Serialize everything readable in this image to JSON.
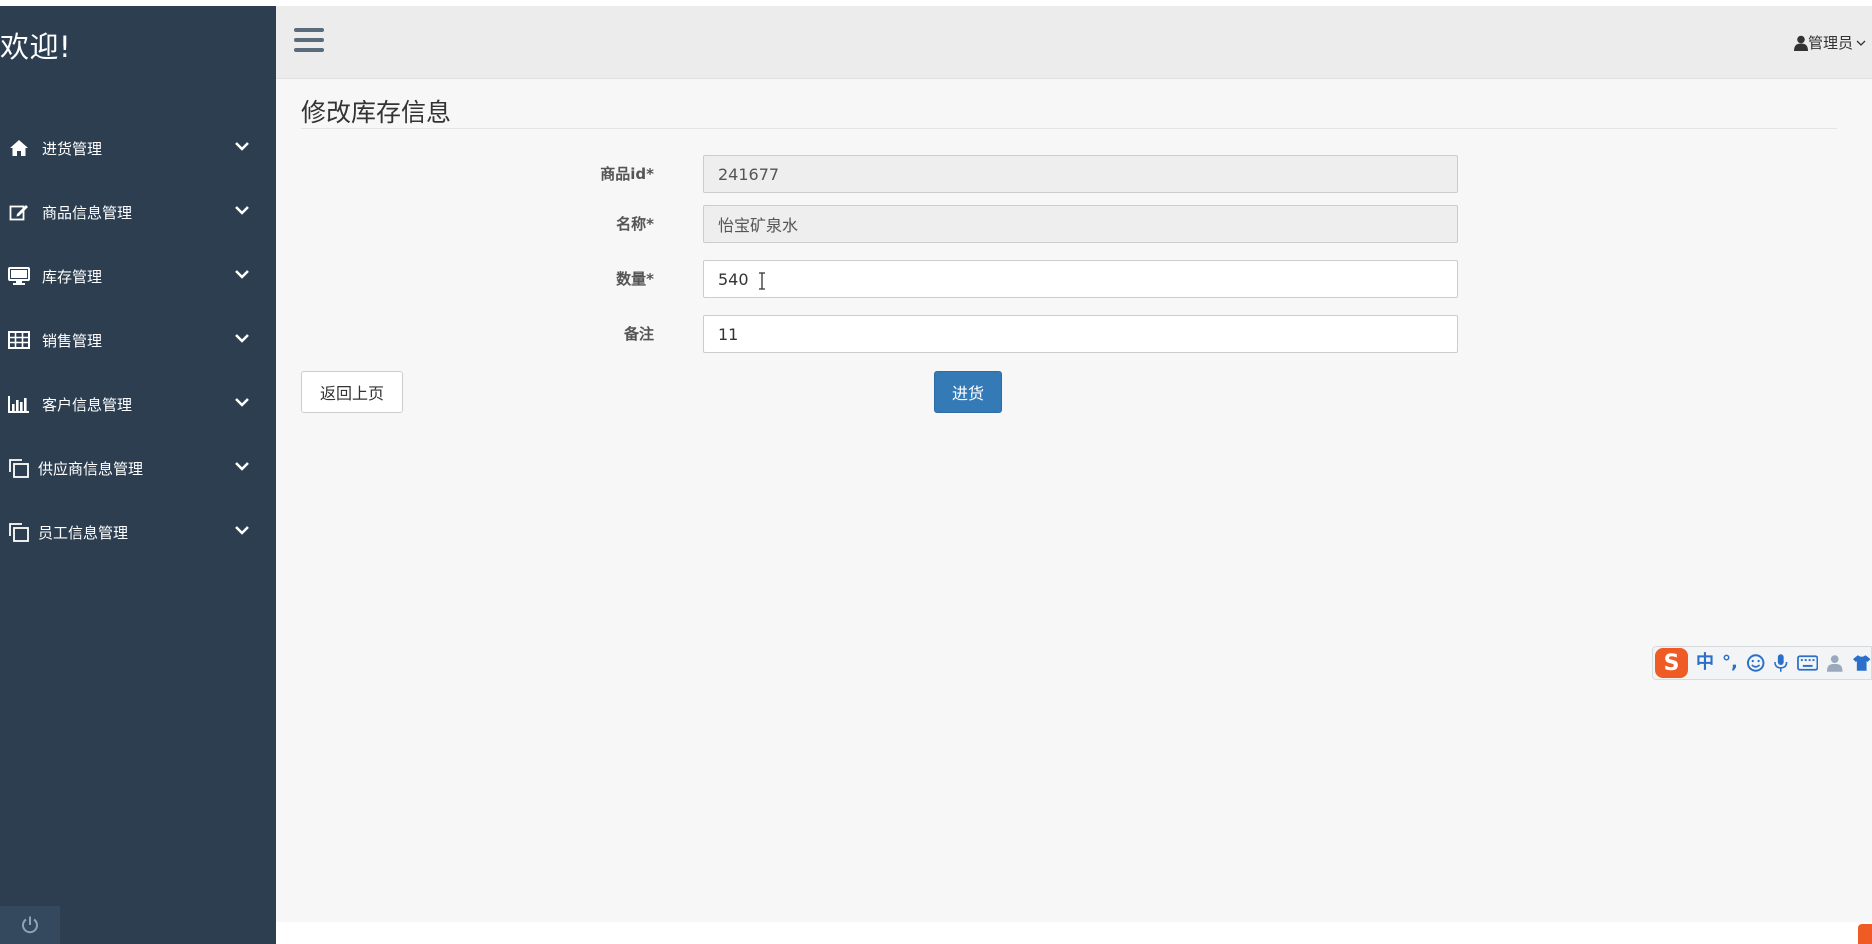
{
  "sidebar": {
    "brand": "欢迎!",
    "items": [
      {
        "label": "进货管理",
        "icon": "home-icon"
      },
      {
        "label": "商品信息管理",
        "icon": "edit-icon"
      },
      {
        "label": "库存管理",
        "icon": "monitor-icon"
      },
      {
        "label": "销售管理",
        "icon": "table-icon"
      },
      {
        "label": "客户信息管理",
        "icon": "bar-chart-icon"
      },
      {
        "label": "供应商信息管理",
        "icon": "copy-icon"
      },
      {
        "label": "员工信息管理",
        "icon": "copy-icon"
      }
    ],
    "power_icon": "power-icon"
  },
  "topbar": {
    "menu_icon": "hamburger-icon",
    "user_label": "管理员"
  },
  "main": {
    "title": "修改库存信息",
    "fields": [
      {
        "label": "商品id*",
        "value": "241677",
        "readonly": true
      },
      {
        "label": "名称*",
        "value": "怡宝矿泉水",
        "readonly": true
      },
      {
        "label": "数量*",
        "value": "540",
        "readonly": false
      },
      {
        "label": "备注",
        "value": "11",
        "readonly": false
      }
    ],
    "back_button": "返回上页",
    "submit_button": "进货"
  },
  "ime": {
    "logo": "S",
    "mode": "中",
    "punct": "°,"
  },
  "colors": {
    "sidebar_bg": "#2c3e50",
    "topbar_bg": "#ececec",
    "main_bg": "#f7f7f7",
    "primary": "#337ab7"
  }
}
